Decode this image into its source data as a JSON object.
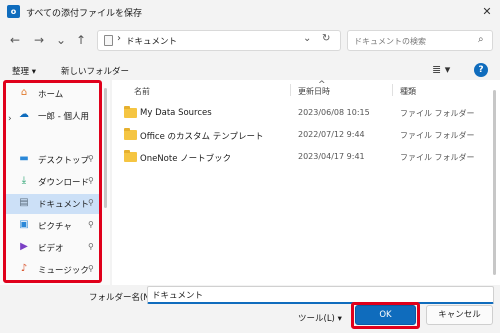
{
  "window": {
    "title": "すべての添付ファイルを保存",
    "app_icon": "outlook-icon",
    "close_glyph": "✕"
  },
  "nav_buttons": {
    "back": "←",
    "forward": "→",
    "recent": "⌄",
    "up": "↑"
  },
  "address": {
    "separator": "›",
    "path": "ドキュメント",
    "dropdown_glyph": "⌄",
    "refresh_glyph": "↻"
  },
  "search": {
    "placeholder": "ドキュメントの検索",
    "icon": "search-icon",
    "glyph": "⌕"
  },
  "toolbar": {
    "organize_label": "整理 ▾",
    "new_folder_label": "新しいフォルダー",
    "view_glyph": "≣ ▾",
    "help_glyph": "?"
  },
  "sidebar": {
    "expander_glyph": "›",
    "pin_glyph": "⚲",
    "items": [
      {
        "label": "ホーム",
        "icon": "home-icon",
        "glyph": "⌂",
        "color": "#e07a2c",
        "pinned": false
      },
      {
        "label": "一郎 - 個人用",
        "icon": "onedrive-cloud-icon",
        "glyph": "☁",
        "color": "#0f6cbd",
        "pinned": false
      },
      {
        "label": "デスクトップ",
        "icon": "desktop-icon",
        "glyph": "▬",
        "color": "#2b88d8",
        "pinned": true
      },
      {
        "label": "ダウンロード",
        "icon": "download-icon",
        "glyph": "⤓",
        "color": "#1e9e6a",
        "pinned": true
      },
      {
        "label": "ドキュメント",
        "icon": "documents-icon",
        "glyph": "▤",
        "color": "#5a6b7c",
        "pinned": true,
        "selected": true
      },
      {
        "label": "ピクチャ",
        "icon": "pictures-icon",
        "glyph": "▣",
        "color": "#2b88d8",
        "pinned": true
      },
      {
        "label": "ビデオ",
        "icon": "video-icon",
        "glyph": "▶",
        "color": "#7a3fc4",
        "pinned": true
      },
      {
        "label": "ミュージック",
        "icon": "music-icon",
        "glyph": "♪",
        "color": "#d9532b",
        "pinned": true
      }
    ]
  },
  "columns": {
    "name": "名前",
    "date": "更新日時",
    "type": "種類",
    "sort_glyph": "^"
  },
  "files": [
    {
      "name": "My Data Sources",
      "date": "2023/06/08 10:15",
      "type": "ファイル フォルダー"
    },
    {
      "name": "Office のカスタム テンプレート",
      "date": "2022/07/12 9:44",
      "type": "ファイル フォルダー"
    },
    {
      "name": "OneNote ノートブック",
      "date": "2023/04/17 9:41",
      "type": "ファイル フォルダー"
    }
  ],
  "footer": {
    "filename_label": "フォルダー名(N):",
    "filename_value": "ドキュメント",
    "tools_label": "ツール(L) ▾",
    "ok_label": "OK",
    "cancel_label": "キャンセル"
  },
  "highlight_color": "#e0001b",
  "accent_color": "#0f6cbd"
}
